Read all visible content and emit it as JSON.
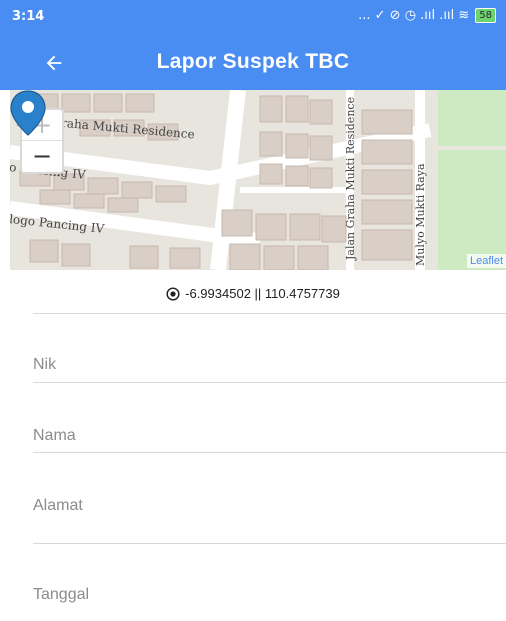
{
  "status_bar": {
    "time": "3:14",
    "icons": "... ✓ ⊘ ◷ .ııl .ııl ≋",
    "battery": "58"
  },
  "app_bar": {
    "title": "Lapor Suspek TBC",
    "back_icon": "arrow-left-icon"
  },
  "map": {
    "zoom_in": "+",
    "zoom_out": "−",
    "attribution": "Leaflet",
    "labels": {
      "residence": "Jalan Graha Mukti Residence",
      "residence_road": "Jalan Graha Mukti Residence",
      "pancing_top": "o Pancing IV",
      "pancing_bottom": "logo Pancing IV",
      "mulyo": "Mulyo Mukti Raya"
    }
  },
  "location": {
    "coords_text": "-6.9934502 || 110.4757739"
  },
  "form": {
    "fields": [
      {
        "placeholder": "Nik"
      },
      {
        "placeholder": "Nama"
      },
      {
        "placeholder": "Alamat"
      },
      {
        "placeholder": "Tanggal"
      }
    ]
  },
  "colors": {
    "primary": "#4a8df2",
    "marker": "#2a81cb"
  }
}
